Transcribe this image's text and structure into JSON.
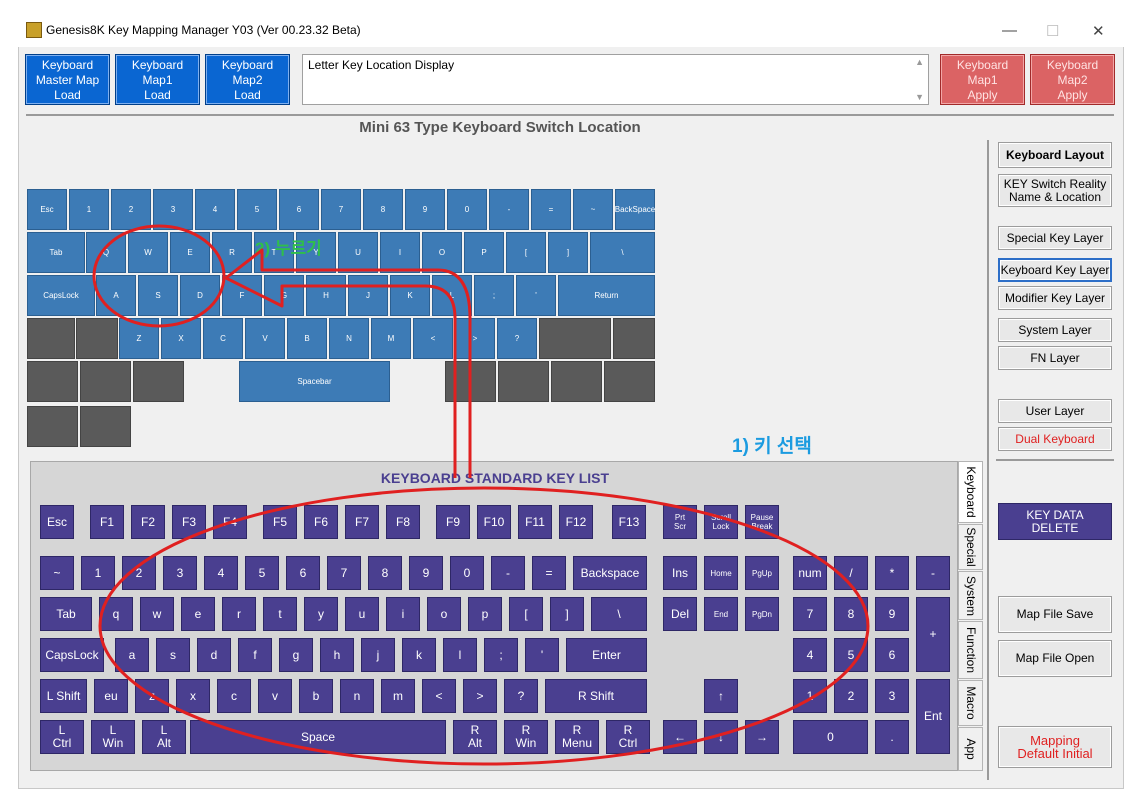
{
  "app": {
    "title": "Genesis8K Key Mapping Manager Y03 (Ver 00.23.32 Beta)"
  },
  "window_controls": {
    "minimize": "—",
    "maximize": "☐",
    "close": "✕"
  },
  "toolbar": {
    "master_load": "Keyboard\nMaster Map\nLoad",
    "map1_load": "Keyboard\nMap1\nLoad",
    "map2_load": "Keyboard\nMap2\nLoad",
    "display_text": "Letter Key Location Display",
    "map1_apply": "Keyboard\nMap1\nApply",
    "map2_apply": "Keyboard\nMap2\nApply"
  },
  "layout_title": "Mini 63 Type Keyboard Switch Location",
  "annotations": {
    "step1": "1) 키 선택",
    "step2": "2) 누르기"
  },
  "std_title": "KEYBOARD STANDARD KEY LIST",
  "sidebar": {
    "keyboard_layout": "Keyboard Layout",
    "key_switch_reality": "KEY Switch Reality\nName & Location",
    "special_key_layer": "Special Key Layer",
    "keyboard_key_layer": "Keyboard Key Layer",
    "modifier_key_layer": "Modifier Key Layer",
    "system_layer": "System Layer",
    "fn_layer": "FN Layer",
    "user_layer": "User Layer",
    "dual_keyboard": "Dual Keyboard",
    "key_data_delete": "KEY DATA\nDELETE",
    "map_file_save": "Map File Save",
    "map_file_open": "Map File Open",
    "mapping_default_initial": "Mapping\nDefault Initial"
  },
  "tabs": [
    "Keyboard",
    "Special",
    "System",
    "Function",
    "Macro",
    "App"
  ],
  "colors": {
    "layout_key": "#3d7bb6",
    "layout_empty": "#5a5a5a",
    "std_key": "#4a3f90",
    "apply_red": "#db6364",
    "load_blue": "#0a66d2",
    "annotation": "#e02020"
  },
  "mini_keys": [
    [
      "Esc",
      "1",
      "2",
      "3",
      "4",
      "5",
      "6",
      "7",
      "8",
      "9",
      "0",
      "-",
      "=",
      "~",
      "BackSpace"
    ],
    [
      "Tab",
      "Q",
      "W",
      "E",
      "R",
      "T",
      "Y",
      "U",
      "I",
      "O",
      "P",
      "[",
      "]",
      "\\"
    ],
    [
      "CapsLock",
      "A",
      "S",
      "D",
      "F",
      "G",
      "H",
      "J",
      "K",
      "L",
      ";",
      "'",
      "Return"
    ],
    [
      "",
      "",
      "Z",
      "X",
      "C",
      "V",
      "B",
      "N",
      "M",
      "<",
      ">",
      "?",
      "",
      ""
    ],
    [
      "",
      "",
      "",
      "Spacebar",
      "",
      "",
      "",
      ""
    ],
    [
      "",
      ""
    ]
  ],
  "std_keys": [
    [
      "Esc",
      "F1",
      "F2",
      "F3",
      "F4",
      "F5",
      "F6",
      "F7",
      "F8",
      "F9",
      "F10",
      "F11",
      "F12",
      "F13",
      "Prt Scr",
      "Scroll Lock",
      "Pause Break"
    ],
    [
      "~",
      "1",
      "2",
      "3",
      "4",
      "5",
      "6",
      "7",
      "8",
      "9",
      "0",
      "-",
      "=",
      "Backspace",
      "Ins",
      "Home",
      "PgUp",
      "num",
      "/",
      "*",
      "-"
    ],
    [
      "Tab",
      "q",
      "w",
      "e",
      "r",
      "t",
      "y",
      "u",
      "i",
      "o",
      "p",
      "[",
      "]",
      "\\",
      "Del",
      "End",
      "PgDn",
      "7",
      "8",
      "9",
      "+"
    ],
    [
      "CapsLock",
      "a",
      "s",
      "d",
      "f",
      "g",
      "h",
      "j",
      "k",
      "l",
      ";",
      "'",
      "Enter",
      "4",
      "5",
      "6"
    ],
    [
      "L Shift",
      "eu",
      "z",
      "x",
      "c",
      "v",
      "b",
      "n",
      "m",
      "<",
      ">",
      "?",
      "R Shift",
      "↑",
      "1",
      "2",
      "3",
      "Ent"
    ],
    [
      "L Ctrl",
      "L Win",
      "L Alt",
      "Space",
      "R Alt",
      "R Win",
      "R Menu",
      "R Ctrl",
      "←",
      "↓",
      "→",
      "0",
      "."
    ]
  ]
}
